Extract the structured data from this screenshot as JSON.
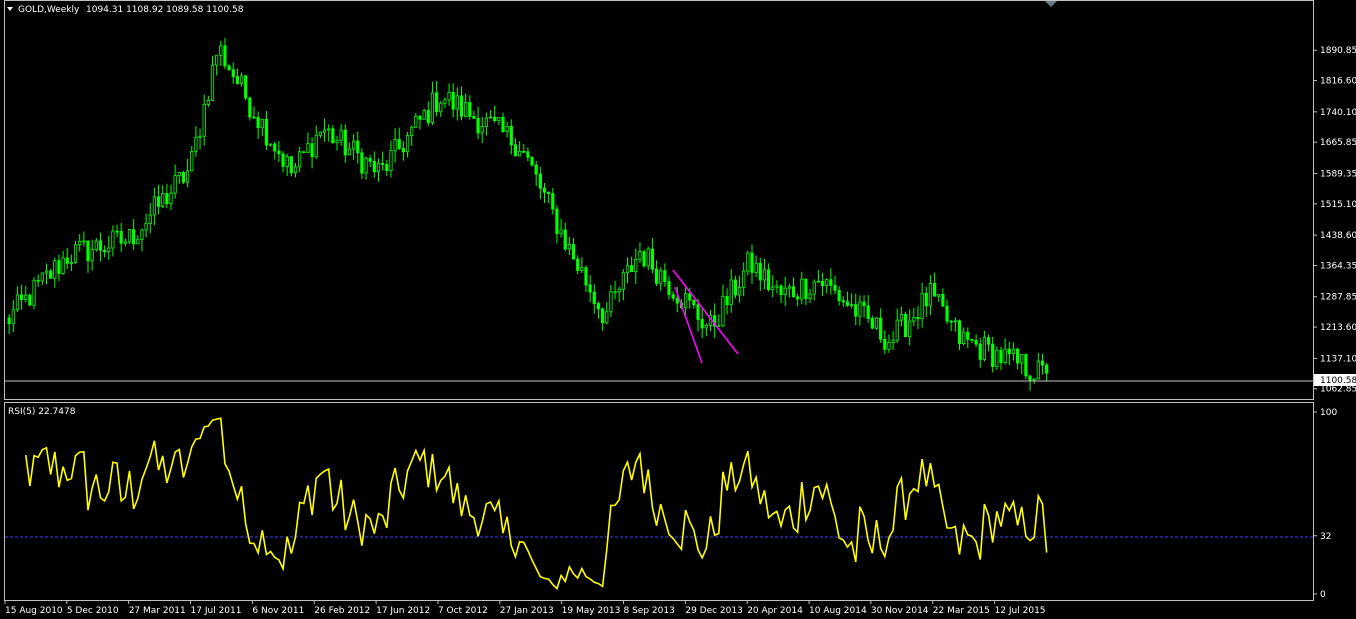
{
  "header": {
    "symbol": "GOLD,Weekly",
    "ohlc": "1094.31 1108.92 1089.58 1100.58"
  },
  "price_panel": {
    "y_ticks": [
      "1890.85",
      "1816.60",
      "1740.10",
      "1665.85",
      "1589.35",
      "1515.10",
      "1438.60",
      "1364.35",
      "1287.85",
      "1213.60",
      "1137.10",
      "1062.85"
    ],
    "current_price_label": "1100.58",
    "current_price": 1100.58,
    "ylim": [
      1045,
      1955
    ]
  },
  "rsi_panel": {
    "label": "RSI(5) 22.7478",
    "y_ticks": [
      "100",
      "32",
      "0"
    ],
    "level": 32
  },
  "x_ticks": [
    "15 Aug 2010",
    "5 Dec 2010",
    "27 Mar 2011",
    "17 Jul 2011",
    "6 Nov 2011",
    "26 Feb 2012",
    "17 Jun 2012",
    "7 Oct 2012",
    "27 Jan 2013",
    "19 May 2013",
    "8 Sep 2013",
    "29 Dec 2013",
    "20 Apr 2014",
    "10 Aug 2014",
    "30 Nov 2014",
    "22 Mar 2015",
    "12 Jul 2015"
  ],
  "colors": {
    "background": "#000000",
    "frame": "#c0c0c0",
    "candles": "#00ff00",
    "rsi_line": "#ffff00",
    "trend_lines": "#ff00ff",
    "level_line": "#4040ff",
    "price_line": "#c0c0c0"
  },
  "chart_data": [
    {
      "type": "candlestick",
      "title": "GOLD,Weekly",
      "x_range": [
        "15 Aug 2010",
        "12 Jul 2015"
      ],
      "key_points": [
        {
          "date": "15 Aug 2010",
          "close": 1225
        },
        {
          "date": "5 Dec 2010",
          "close": 1390
        },
        {
          "date": "27 Mar 2011",
          "close": 1430
        },
        {
          "date": "17 Jul 2011",
          "close": 1600
        },
        {
          "date": "Aug 2011",
          "close": 1900
        },
        {
          "date": "6 Nov 2011",
          "close": 1760
        },
        {
          "date": "Dec 2011",
          "close": 1590
        },
        {
          "date": "26 Feb 2012",
          "close": 1700
        },
        {
          "date": "17 Jun 2012",
          "close": 1590
        },
        {
          "date": "7 Oct 2012",
          "close": 1780
        },
        {
          "date": "27 Jan 2013",
          "close": 1660
        },
        {
          "date": "Apr 2013",
          "close": 1400
        },
        {
          "date": "19 May 2013",
          "close": 1240
        },
        {
          "date": "Aug 2013",
          "close": 1400
        },
        {
          "date": "29 Dec 2013",
          "close": 1210
        },
        {
          "date": "Mar 2014",
          "close": 1370
        },
        {
          "date": "20 Apr 2014",
          "close": 1290
        },
        {
          "date": "Jul 2014",
          "close": 1330
        },
        {
          "date": "30 Nov 2014",
          "close": 1180
        },
        {
          "date": "Jan 2015",
          "close": 1290
        },
        {
          "date": "22 Mar 2015",
          "close": 1185
        },
        {
          "date": "12 Jul 2015",
          "close": 1100
        }
      ],
      "current_close": 1100.58
    },
    {
      "type": "line",
      "title": "RSI(5) 22.7478",
      "ylim": [
        0,
        100
      ],
      "level": 32,
      "last_value": 22.7478
    }
  ]
}
